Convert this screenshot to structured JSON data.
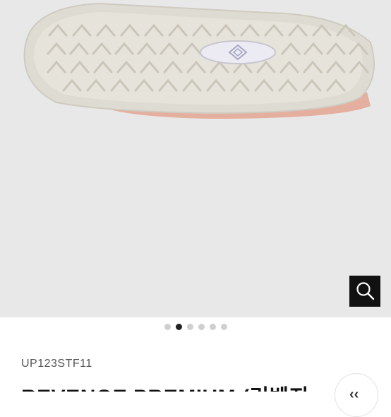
{
  "gallery": {
    "product_image": "shoe-sole-photo",
    "sole_logo_icon": "umbro-diamond-logo",
    "dots_count": 6,
    "active_dot_index": 1,
    "zoom_icon": "magnifier-icon"
  },
  "product": {
    "code": "UP123STF11",
    "title": "REVENGE PREMIUM (리벤지",
    "share_icon": "share-icon",
    "share_glyph": "‹‹"
  }
}
